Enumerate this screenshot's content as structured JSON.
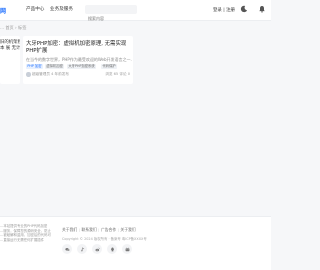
{
  "header": {
    "logo": "网",
    "nav": [
      "产品中心",
      "业务及服务"
    ],
    "search_placeholder": "搜索内容",
    "login": "登录",
    "register": "注册",
    "separator": "|"
  },
  "breadcrumb": "... 首页 › 标签",
  "left_card": {
    "title_lines": [
      "旧的机架程",
      "本 展 无计"
    ]
  },
  "article": {
    "title": "大牙PHP加密：虚拟机加密原理, 无需实现PHP扩展",
    "description": "在当今的数字世界，PHP作为最受欢迎的Web开发语言之一...",
    "tags": [
      "PHP 加密",
      "虚拟机加密",
      "大牙PHP加密系统",
      "代码保护"
    ],
    "author": "超级管理员",
    "date": "4 年前发布",
    "views": "浏览 65",
    "comments": "评论 0"
  },
  "footer": {
    "about_lines": [
      "…本站提供专业的PHP代码加密",
      "…服务，保障您的源码安全，防止",
      "…被破解和盗用，加密后的代码可",
      "…直接运行无需任何扩展插件"
    ],
    "links": [
      "关于我们",
      "联系我们",
      "广告合作",
      "关于我们"
    ],
    "copyright": "Copyright © 2024 版权所有 · 备案号 粤ICP备XXXX号",
    "social_icons": [
      "wechat-icon",
      "tiktok-icon",
      "weibo-icon",
      "qq-icon",
      "bilibili-icon"
    ]
  },
  "colors": {
    "accent": "#1e6fff",
    "background": "#f6f7f9"
  }
}
